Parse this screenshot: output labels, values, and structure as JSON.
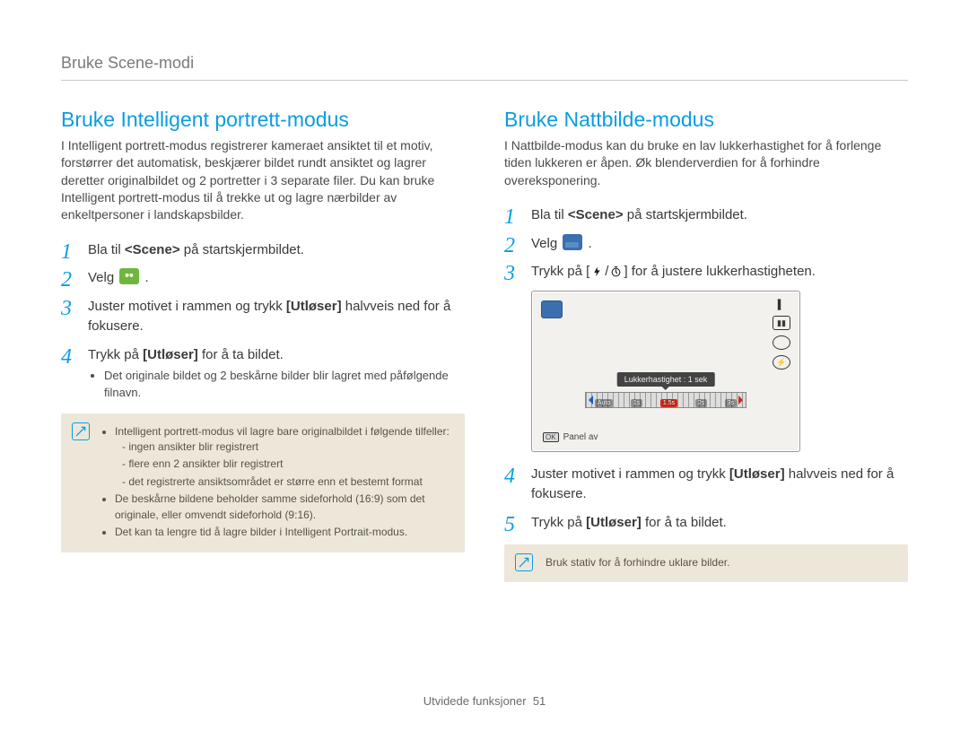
{
  "breadcrumb": "Bruke Scene-modi",
  "footer": {
    "section": "Utvidede funksjoner",
    "page": "51"
  },
  "left": {
    "title": "Bruke Intelligent portrett-modus",
    "intro": "I Intelligent portrett-modus registrerer kameraet ansiktet til et motiv, forstørrer det automatisk, beskjærer bildet rundt ansiktet og lagrer deretter originalbildet og 2 portretter i 3 separate filer. Du kan bruke Intelligent portrett-modus til å trekke ut og lagre nærbilder av enkeltpersoner i landskapsbilder.",
    "step1_a": "Bla til ",
    "step1_tag": "<Scene>",
    "step1_b": " på startskjermbildet.",
    "step2": "Velg ",
    "step3_a": "Juster motivet i rammen og trykk ",
    "step3_btn": "[Utløser]",
    "step3_b": " halvveis ned for å fokusere.",
    "step4_a": "Trykk på ",
    "step4_btn": "[Utløser]",
    "step4_b": " for å ta bildet.",
    "step4_sub": "Det originale bildet og 2 beskårne bilder blir lagret med påfølgende filnavn.",
    "note": {
      "line1": "Intelligent portrett-modus vil lagre bare originalbildet i følgende tilfeller:",
      "d1": "ingen ansikter blir registrert",
      "d2": "flere enn 2 ansikter blir registrert",
      "d3": "det registrerte ansiktsområdet er større enn et bestemt format",
      "line2": "De beskårne bildene beholder samme sideforhold (16:9) som det originale, eller omvendt sideforhold (9:16).",
      "line3": "Det kan ta lengre tid å lagre bilder i Intelligent Portrait-modus."
    }
  },
  "right": {
    "title": "Bruke Nattbilde-modus",
    "intro": "I Nattbilde-modus kan du bruke en lav lukkerhastighet for å forlenge tiden lukkeren er åpen. Øk blenderverdien for å forhindre overeksponering.",
    "step1_a": "Bla til ",
    "step1_tag": "<Scene>",
    "step1_b": " på startskjermbildet.",
    "step2": "Velg ",
    "step3_a": "Trykk på [",
    "step3_b": "] for å justere lukkerhastigheten.",
    "lcd": {
      "tooltip": "Lukkerhastighet : 1 sek",
      "scale": [
        "Auto",
        "1s",
        "1.5s",
        "2s",
        "3s"
      ],
      "panel_off": "Panel av",
      "ok": "OK"
    },
    "step4_a": "Juster motivet i rammen og trykk ",
    "step4_btn": "[Utløser]",
    "step4_b": " halvveis ned for å fokusere.",
    "step5_a": "Trykk på ",
    "step5_btn": "[Utløser]",
    "step5_b": " for å ta bildet.",
    "note": "Bruk stativ for å forhindre uklare bilder."
  }
}
